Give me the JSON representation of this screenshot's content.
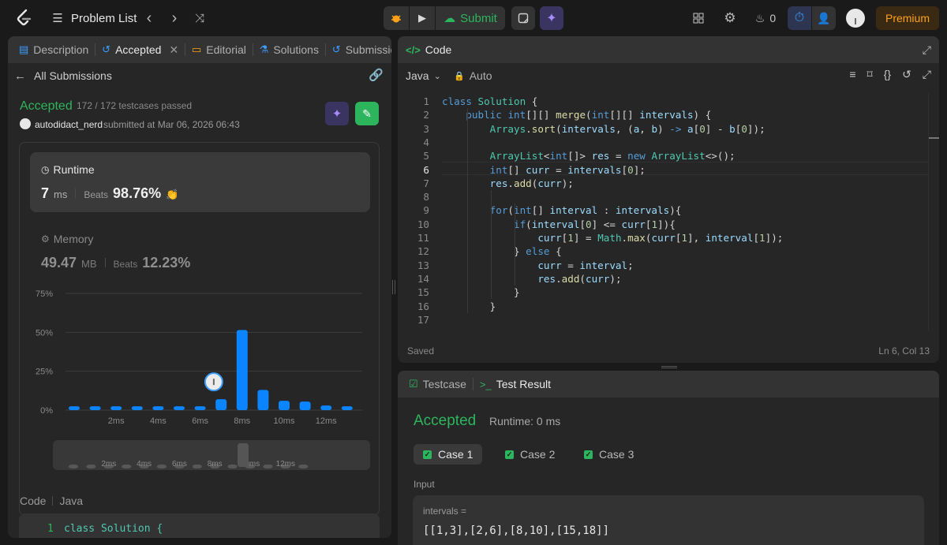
{
  "topbar": {
    "problem_list": "Problem List",
    "submit_label": "Submit",
    "streak_count": "0",
    "premium_label": "Premium"
  },
  "left_panel": {
    "tabs": [
      {
        "label": "Description",
        "icon": "description-icon"
      },
      {
        "label": "Accepted",
        "icon": "history-icon"
      },
      {
        "label": "Editorial",
        "icon": "book-icon"
      },
      {
        "label": "Solutions",
        "icon": "flask-icon"
      },
      {
        "label": "Submissio",
        "icon": "history-icon"
      }
    ],
    "all_submissions": "All Submissions",
    "status": "Accepted",
    "testcases": "172 / 172 testcases passed",
    "username": "autodidact_nerd",
    "submitted_at": "submitted at Mar 06, 2026 06:43",
    "runtime": {
      "title": "Runtime",
      "value": "7",
      "unit": "ms",
      "beats_label": "Beats",
      "beats_value": "98.76%"
    },
    "memory": {
      "title": "Memory",
      "value": "49.47",
      "unit": "MB",
      "beats_label": "Beats",
      "beats_value": "12.23%"
    },
    "code_label": "Code",
    "code_lang": "Java",
    "code_preview": {
      "line_no": "1",
      "text": "class Solution {"
    }
  },
  "chart_data": {
    "type": "bar",
    "y_ticks": [
      "75%",
      "50%",
      "25%",
      "0%"
    ],
    "ylim": [
      0,
      75
    ],
    "x_tick_labels": [
      "2ms",
      "4ms",
      "6ms",
      "8ms",
      "10ms",
      "12ms"
    ],
    "values": [
      2.5,
      2.5,
      2.5,
      2.5,
      2.5,
      2.5,
      2.5,
      7,
      51.5,
      13,
      6,
      5.5,
      3,
      2.5
    ],
    "highlight_index": 7,
    "bar_color": "#0a84ff"
  },
  "editor": {
    "title": "Code",
    "language": "Java",
    "mode": "Auto",
    "status": "Saved",
    "cursor": "Ln 6, Col 13",
    "lines": [
      {
        "n": "1",
        "text": "class Solution {"
      },
      {
        "n": "2",
        "text": "    public int[][] merge(int[][] intervals) {"
      },
      {
        "n": "3",
        "text": "        Arrays.sort(intervals, (a, b) -> a[0] - b[0]);"
      },
      {
        "n": "4",
        "text": ""
      },
      {
        "n": "5",
        "text": "        ArrayList<int[]> res = new ArrayList<>();"
      },
      {
        "n": "6",
        "text": "        int[] curr = intervals[0];"
      },
      {
        "n": "7",
        "text": "        res.add(curr);"
      },
      {
        "n": "8",
        "text": ""
      },
      {
        "n": "9",
        "text": "        for(int[] interval : intervals){"
      },
      {
        "n": "10",
        "text": "            if(interval[0] <= curr[1]){"
      },
      {
        "n": "11",
        "text": "                curr[1] = Math.max(curr[1], interval[1]);"
      },
      {
        "n": "12",
        "text": "            } else {"
      },
      {
        "n": "13",
        "text": "                curr = interval;"
      },
      {
        "n": "14",
        "text": "                res.add(curr);"
      },
      {
        "n": "15",
        "text": "            }"
      },
      {
        "n": "16",
        "text": "        }"
      },
      {
        "n": "17",
        "text": ""
      }
    ]
  },
  "test_panel": {
    "tab_testcase": "Testcase",
    "tab_result": "Test Result",
    "status": "Accepted",
    "runtime": "Runtime: 0 ms",
    "cases": [
      "Case 1",
      "Case 2",
      "Case 3"
    ],
    "input_label": "Input",
    "param_name": "intervals =",
    "param_value": "[[1,3],[2,6],[8,10],[15,18]]"
  },
  "colors": {
    "accent_green": "#2db55d",
    "premium": "#ffa116",
    "bar": "#0a84ff"
  }
}
